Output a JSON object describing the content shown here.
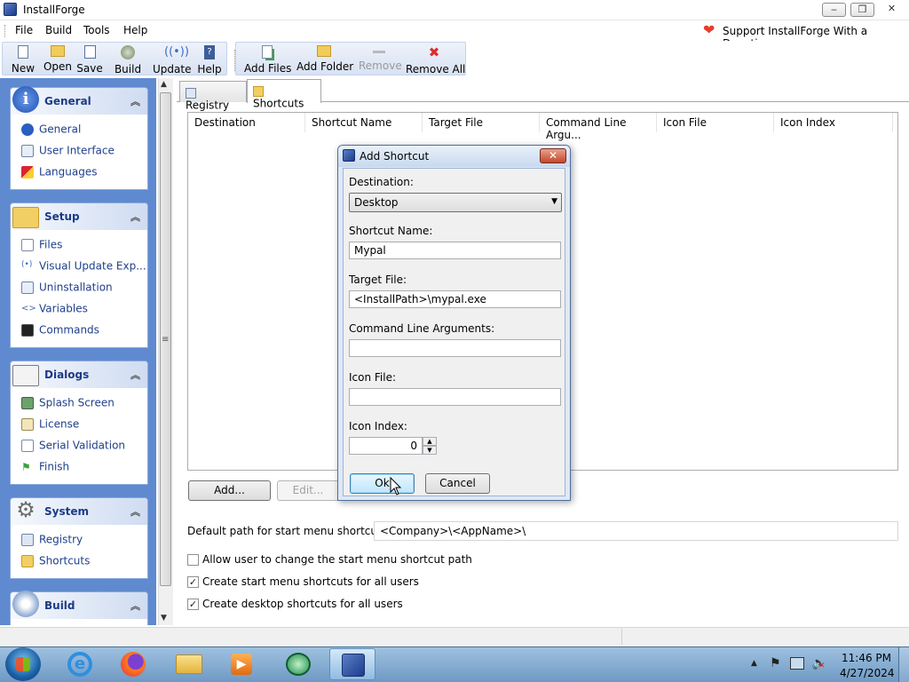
{
  "window": {
    "title": "InstallForge",
    "min": "▭",
    "max": "⧉",
    "close": "✕"
  },
  "menu": {
    "items": [
      "File",
      "Build",
      "Tools",
      "Help"
    ],
    "support": "Support InstallForge With a Donation"
  },
  "toolbar": {
    "new": "New",
    "open": "Open",
    "save": "Save",
    "build": "Build",
    "update": "Update",
    "help": "Help",
    "add_files": "Add Files",
    "add_folder": "Add Folder",
    "remove": "Remove",
    "remove_all": "Remove All"
  },
  "sidebar": {
    "general": {
      "title": "General",
      "items": [
        "General",
        "User Interface",
        "Languages"
      ]
    },
    "setup": {
      "title": "Setup",
      "items": [
        "Files",
        "Visual Update Exp...",
        "Uninstallation",
        "Variables",
        "Commands"
      ]
    },
    "dialogs": {
      "title": "Dialogs",
      "items": [
        "Splash Screen",
        "License",
        "Serial Validation",
        "Finish"
      ]
    },
    "system": {
      "title": "System",
      "items": [
        "Registry",
        "Shortcuts"
      ]
    },
    "build": {
      "title": "Build"
    }
  },
  "tabs": [
    "Registry",
    "Shortcuts"
  ],
  "table": {
    "columns": [
      "Destination",
      "Shortcut Name",
      "Target File",
      "Command Line Argu...",
      "Icon File",
      "Icon Index"
    ]
  },
  "buttons": {
    "add": "Add...",
    "edit": "Edit..."
  },
  "options": {
    "default_path_label": "Default path for start menu shortcuts:",
    "default_path_value": "<Company>\\<AppName>\\",
    "allow_change": "Allow user to change the start menu shortcut path",
    "startmenu_all_users": "Create start menu shortcuts for all users",
    "desktop_all_users": "Create desktop shortcuts for all users"
  },
  "dialog": {
    "title": "Add Shortcut",
    "destination_label": "Destination:",
    "destination_value": "Desktop",
    "shortcut_name_label": "Shortcut Name:",
    "shortcut_name_value": "Mypal",
    "target_file_label": "Target File:",
    "target_file_value": "<InstallPath>\\mypal.exe",
    "cmd_args_label": "Command Line Arguments:",
    "cmd_args_value": "",
    "icon_file_label": "Icon File:",
    "icon_file_value": "",
    "icon_index_label": "Icon Index:",
    "icon_index_value": "0",
    "ok": "Ok",
    "cancel": "Cancel"
  },
  "taskbar": {
    "time": "11:46 PM",
    "date": "4/27/2024"
  }
}
